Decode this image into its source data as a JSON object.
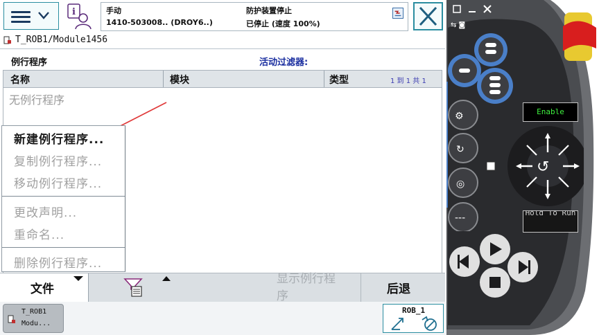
{
  "topbar": {
    "mode": "手动",
    "controller": "1410-503008.. (DROY6..)",
    "state_title": "防护装置停止",
    "state": "已停止 (速度 100%)"
  },
  "window": {
    "title": "T_ROB1/Module1456"
  },
  "routines": {
    "section_title": "例行程序",
    "active_filter_label": "活动过滤器:",
    "columns": [
      "名称",
      "模块",
      "类型"
    ],
    "paging": "1 到 1 共 1",
    "empty_text": "无例行程序"
  },
  "file_menu": {
    "items": [
      {
        "label": "新建例行程序...",
        "enabled": true
      },
      {
        "label": "复制例行程序...",
        "enabled": false
      },
      {
        "label": "移动例行程序...",
        "enabled": false
      },
      {
        "label": "更改声明...",
        "enabled": false
      },
      {
        "label": "重命名...",
        "enabled": false
      },
      {
        "label": "删除例行程序...",
        "enabled": false
      }
    ]
  },
  "bottombar": {
    "file_label": "文件",
    "show_routine_label": "显示例行程序",
    "back_label": "后退"
  },
  "taskbar": {
    "task_line1": "T_ROB1",
    "task_line2": "Modu...",
    "robot_label": "ROB_1"
  },
  "pendant": {
    "enable_label": "Enable",
    "hold_label": "Hold To Run"
  },
  "colors": {
    "accent": "#2a8da0",
    "filter_text": "#1b2fa0",
    "pendant_blue": "#4a7fc8",
    "enable_green": "#3ff03f",
    "emergency_red": "#d81e1e",
    "pointer_red": "#e03a3a"
  },
  "icons": [
    "menu-icon",
    "chevron-down-icon",
    "info-user-icon",
    "status-icon",
    "close-icon",
    "module-icon",
    "filter-icon",
    "robot-axes-icon",
    "joystick-icon"
  ]
}
